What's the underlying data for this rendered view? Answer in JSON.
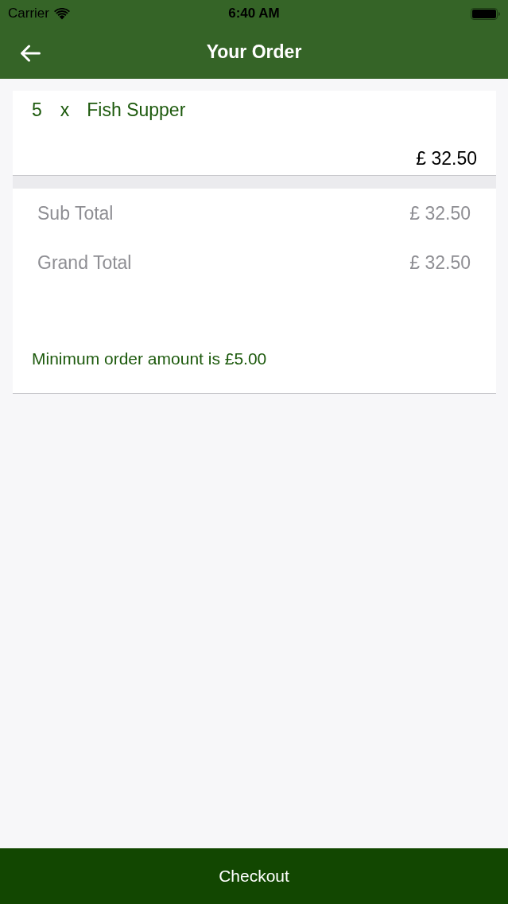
{
  "status_bar": {
    "carrier": "Carrier",
    "time": "6:40 AM"
  },
  "nav_bar": {
    "title": "Your Order"
  },
  "order_items": [
    {
      "quantity": "5",
      "separator": "x",
      "name": "Fish Supper",
      "price": "£ 32.50"
    }
  ],
  "totals": [
    {
      "label": "Sub Total",
      "value": "£ 32.50"
    },
    {
      "label": "Grand Total",
      "value": "£ 32.50"
    }
  ],
  "notice": "Minimum order amount is £5.00",
  "checkout_button": {
    "label": "Checkout"
  }
}
